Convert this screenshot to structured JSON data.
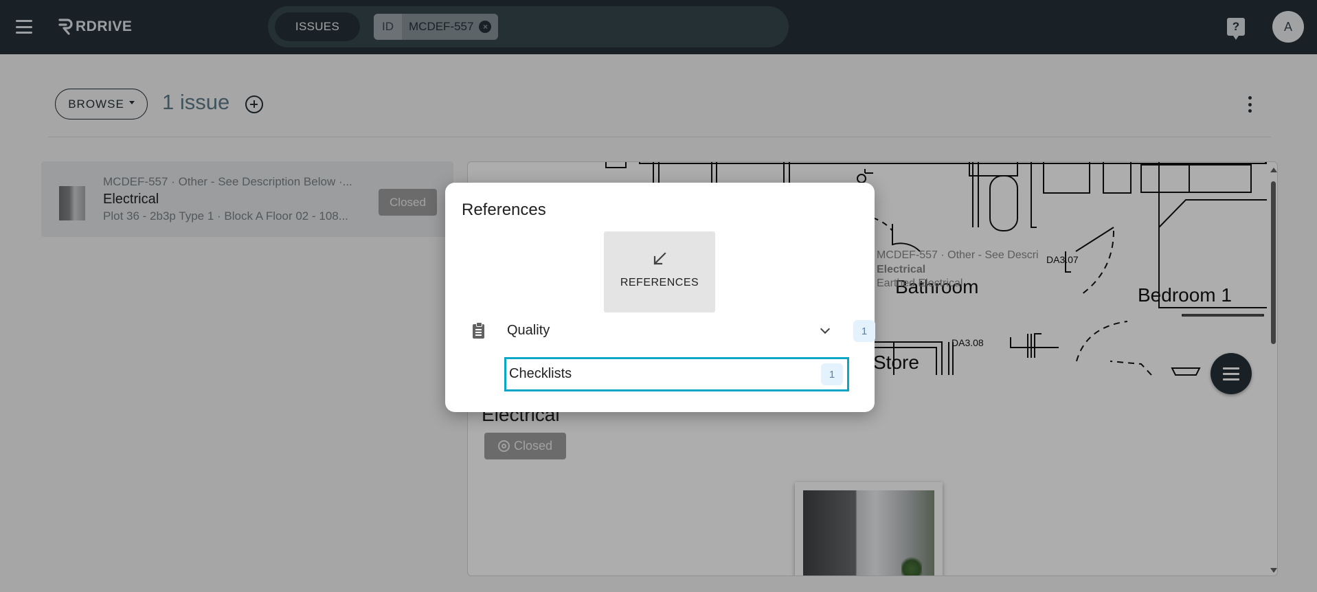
{
  "app": {
    "logo_text": "RDRIVE"
  },
  "search": {
    "scope_label": "ISSUES",
    "filter_key": "ID",
    "filter_value": "MCDEF-557"
  },
  "user": {
    "avatar_initial": "A"
  },
  "header": {
    "browse_label": "BROWSE",
    "issue_count": "1 issue"
  },
  "issue_list": [
    {
      "meta": "MCDEF-557 · Other - See Description Below ·...",
      "title": "Electrical",
      "location": "Plot 36 - 2b3p Type 1 · Block A Floor 02 - 108...",
      "status": "Closed"
    }
  ],
  "detail": {
    "title": "Electrical",
    "status": "Closed",
    "plan_labels": {
      "pin_meta": "MCDEF-557 · Other - See Descri",
      "pin_title": "Electrical",
      "pin_sub": "Earthed Electrical",
      "room_bathroom": "Bathroom",
      "room_bedroom": "Bedroom 1",
      "room_store": "Store",
      "tag_da307": "DA3.07",
      "tag_da308": "DA3.08"
    }
  },
  "dialog": {
    "title": "References",
    "tab_label": "REFERENCES",
    "groups": [
      {
        "label": "Quality",
        "count": "1",
        "items": [
          {
            "label": "Checklists",
            "count": "1"
          }
        ]
      }
    ]
  },
  "colors": {
    "topbar": "#263238",
    "selection_border": "#0aa6c8",
    "badge_bg": "#e3f2fd"
  }
}
